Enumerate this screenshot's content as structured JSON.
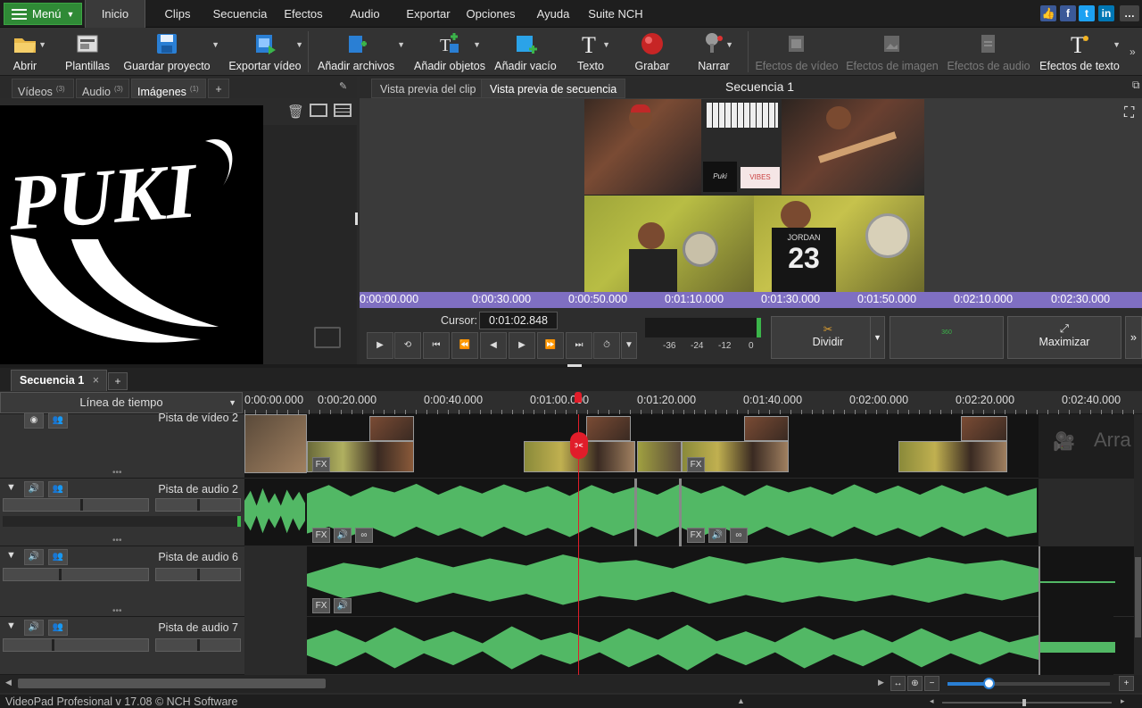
{
  "menubar": {
    "menu_button": "Menú",
    "tabs": [
      "Inicio",
      "Clips",
      "Secuencia",
      "Efectos",
      "Audio",
      "Exportar",
      "Opciones",
      "Ayuda",
      "Suite NCH"
    ],
    "active_tab": "Inicio",
    "social_icons": [
      "thumbs-up-icon",
      "facebook-icon",
      "twitter-icon",
      "linkedin-icon"
    ]
  },
  "toolbar": {
    "buttons": [
      {
        "label": "Abrir",
        "icon": "folder-open-icon"
      },
      {
        "label": "Plantillas",
        "icon": "templates-icon"
      },
      {
        "label": "Guardar proyecto",
        "icon": "save-icon"
      },
      {
        "label": "Exportar vídeo",
        "icon": "export-video-icon"
      },
      {
        "label": "Añadir archivos",
        "icon": "add-files-icon"
      },
      {
        "label": "Añadir objetos",
        "icon": "add-objects-icon"
      },
      {
        "label": "Añadir vacío",
        "icon": "add-blank-icon"
      },
      {
        "label": "Texto",
        "icon": "text-icon"
      },
      {
        "label": "Grabar",
        "icon": "record-icon"
      },
      {
        "label": "Narrar",
        "icon": "microphone-icon"
      },
      {
        "label": "Efectos de vídeo",
        "icon": "video-effects-icon"
      },
      {
        "label": "Efectos de imagen",
        "icon": "image-effects-icon"
      },
      {
        "label": "Efectos de audio",
        "icon": "audio-effects-icon"
      },
      {
        "label": "Efectos de texto",
        "icon": "text-effects-icon"
      }
    ]
  },
  "media": {
    "tabs": [
      {
        "label": "Vídeos",
        "count": "(3)"
      },
      {
        "label": "Audio",
        "count": "(3)"
      },
      {
        "label": "Imágenes",
        "count": "(1)"
      }
    ],
    "add_tab": "+",
    "thumb_text": "PUKI"
  },
  "preview": {
    "tabs": [
      "Vista previa del clip",
      "Vista previa de secuencia"
    ],
    "title": "Secuencia 1",
    "ruler": [
      "0:00:00.000",
      "0:00:30.000",
      "0:00:50.000",
      "0:01:10.000",
      "0:01:30.000",
      "0:01:50.000",
      "0:02:10.000",
      "0:02:30.000"
    ],
    "cursor_label": "Cursor:",
    "cursor_value": "0:01:02.848",
    "meter_labels": [
      "-36",
      "-24",
      "-12",
      "0"
    ],
    "split_label": "Dividir",
    "label_360": "360",
    "maximize_label": "Maximizar",
    "jersey_text": "JORDAN",
    "jersey_number": "23",
    "video_tile_text": "VIBES"
  },
  "timeline": {
    "sequence_tab": "Secuencia 1",
    "add_tab": "+",
    "mode": "Línea de tiempo",
    "ruler": [
      "0:00:00.000",
      "0:00:20.000",
      "0:00:40.000",
      "0:01:00.000",
      "0:01:20.000",
      "0:01:40.000",
      "0:02:00.000",
      "0:02:20.000",
      "0:02:40.000"
    ],
    "tracks": [
      {
        "name": "Pista de vídeo 2"
      },
      {
        "name": "Pista de audio 2"
      },
      {
        "name": "Pista de audio 6"
      },
      {
        "name": "Pista de audio 7"
      }
    ],
    "fx_label": "FX",
    "drop_hint": "Arra"
  },
  "status": {
    "text": "VideoPad Profesional v 17.08 © NCH Software"
  },
  "colors": {
    "accent_green": "#2f8a36",
    "waveform": "#52b865",
    "preview_ruler": "#7f6fc2",
    "playhead": "#e11d2a"
  }
}
